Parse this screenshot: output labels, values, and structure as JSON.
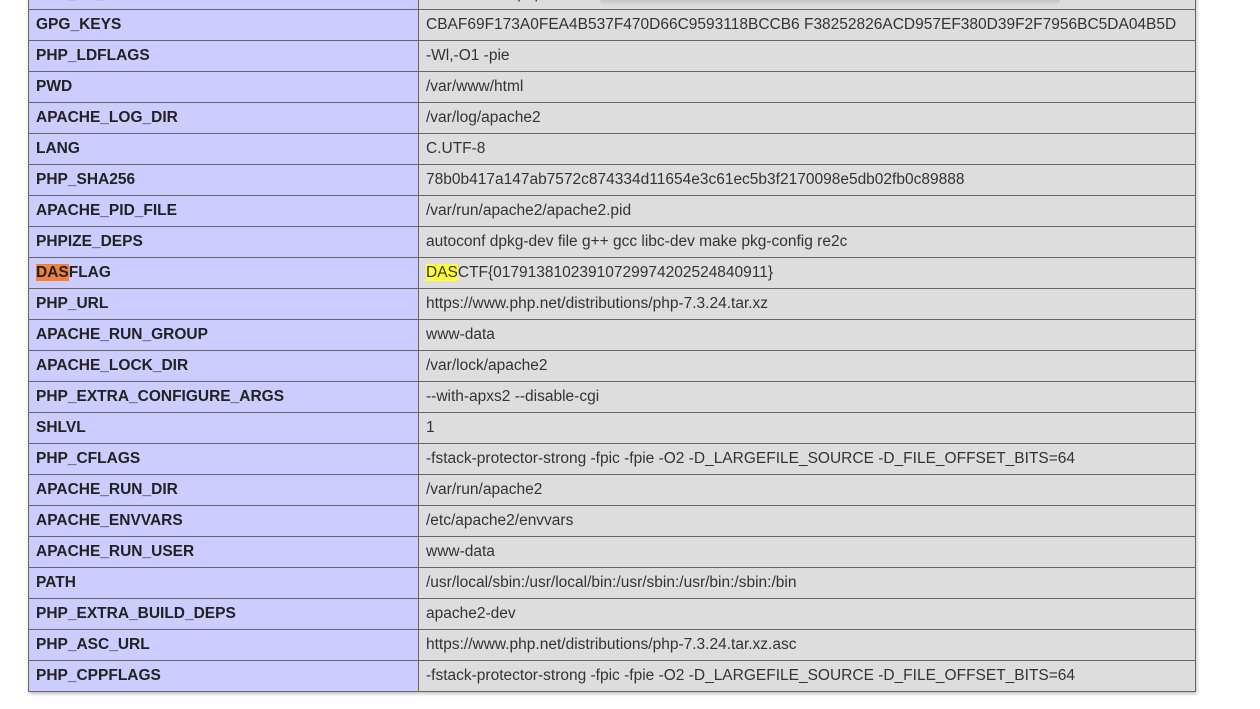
{
  "env_table": {
    "partial_top_row": {
      "key": "PHP_INI_DIR",
      "value": "/usr/local/etc/php"
    },
    "rows": [
      {
        "key": "GPG_KEYS",
        "value": "CBAF69F173A0FEA4B537F470D66C9593118BCCB6 F38252826ACD957EF380D39F2F7956BC5DA04B5D"
      },
      {
        "key": "PHP_LDFLAGS",
        "value": "-Wl,-O1 -pie"
      },
      {
        "key": "PWD",
        "value": "/var/www/html"
      },
      {
        "key": "APACHE_LOG_DIR",
        "value": "/var/log/apache2"
      },
      {
        "key": "LANG",
        "value": "C.UTF-8"
      },
      {
        "key": "PHP_SHA256",
        "value": "78b0b417a147ab7572c874334d11654e3c61ec5b3f2170098e5db02fb0c89888"
      },
      {
        "key": "APACHE_PID_FILE",
        "value": "/var/run/apache2/apache2.pid"
      },
      {
        "key": "PHPIZE_DEPS",
        "value": "autoconf dpkg-dev file g++ gcc libc-dev make pkg-config re2c"
      },
      {
        "key_highlight": "DAS",
        "key_rest": "FLAG",
        "value_highlight": "DAS",
        "value_rest": "CTF{01791381023910729974202524840911}"
      },
      {
        "key": "PHP_URL",
        "value": "https://www.php.net/distributions/php-7.3.24.tar.xz"
      },
      {
        "key": "APACHE_RUN_GROUP",
        "value": "www-data"
      },
      {
        "key": "APACHE_LOCK_DIR",
        "value": "/var/lock/apache2"
      },
      {
        "key": "PHP_EXTRA_CONFIGURE_ARGS",
        "value": "--with-apxs2 --disable-cgi"
      },
      {
        "key": "SHLVL",
        "value": "1"
      },
      {
        "key": "PHP_CFLAGS",
        "value": "-fstack-protector-strong -fpic -fpie -O2 -D_LARGEFILE_SOURCE -D_FILE_OFFSET_BITS=64"
      },
      {
        "key": "APACHE_RUN_DIR",
        "value": "/var/run/apache2"
      },
      {
        "key": "APACHE_ENVVARS",
        "value": "/etc/apache2/envvars"
      },
      {
        "key": "APACHE_RUN_USER",
        "value": "www-data"
      },
      {
        "key": "PATH",
        "value": "/usr/local/sbin:/usr/local/bin:/usr/sbin:/usr/bin:/sbin:/bin"
      },
      {
        "key": "PHP_EXTRA_BUILD_DEPS",
        "value": "apache2-dev"
      },
      {
        "key": "PHP_ASC_URL",
        "value": "https://www.php.net/distributions/php-7.3.24.tar.xz.asc"
      },
      {
        "key": "PHP_CPPFLAGS",
        "value": "-fstack-protector-strong -fpic -fpie -O2 -D_LARGEFILE_SOURCE -D_FILE_OFFSET_BITS=64"
      }
    ]
  },
  "colors": {
    "key_cell_bg": "#ccccff",
    "value_cell_bg": "#dddddd",
    "border": "#666666",
    "search_highlight_active": "#f0823c",
    "search_highlight": "#ffff33"
  }
}
